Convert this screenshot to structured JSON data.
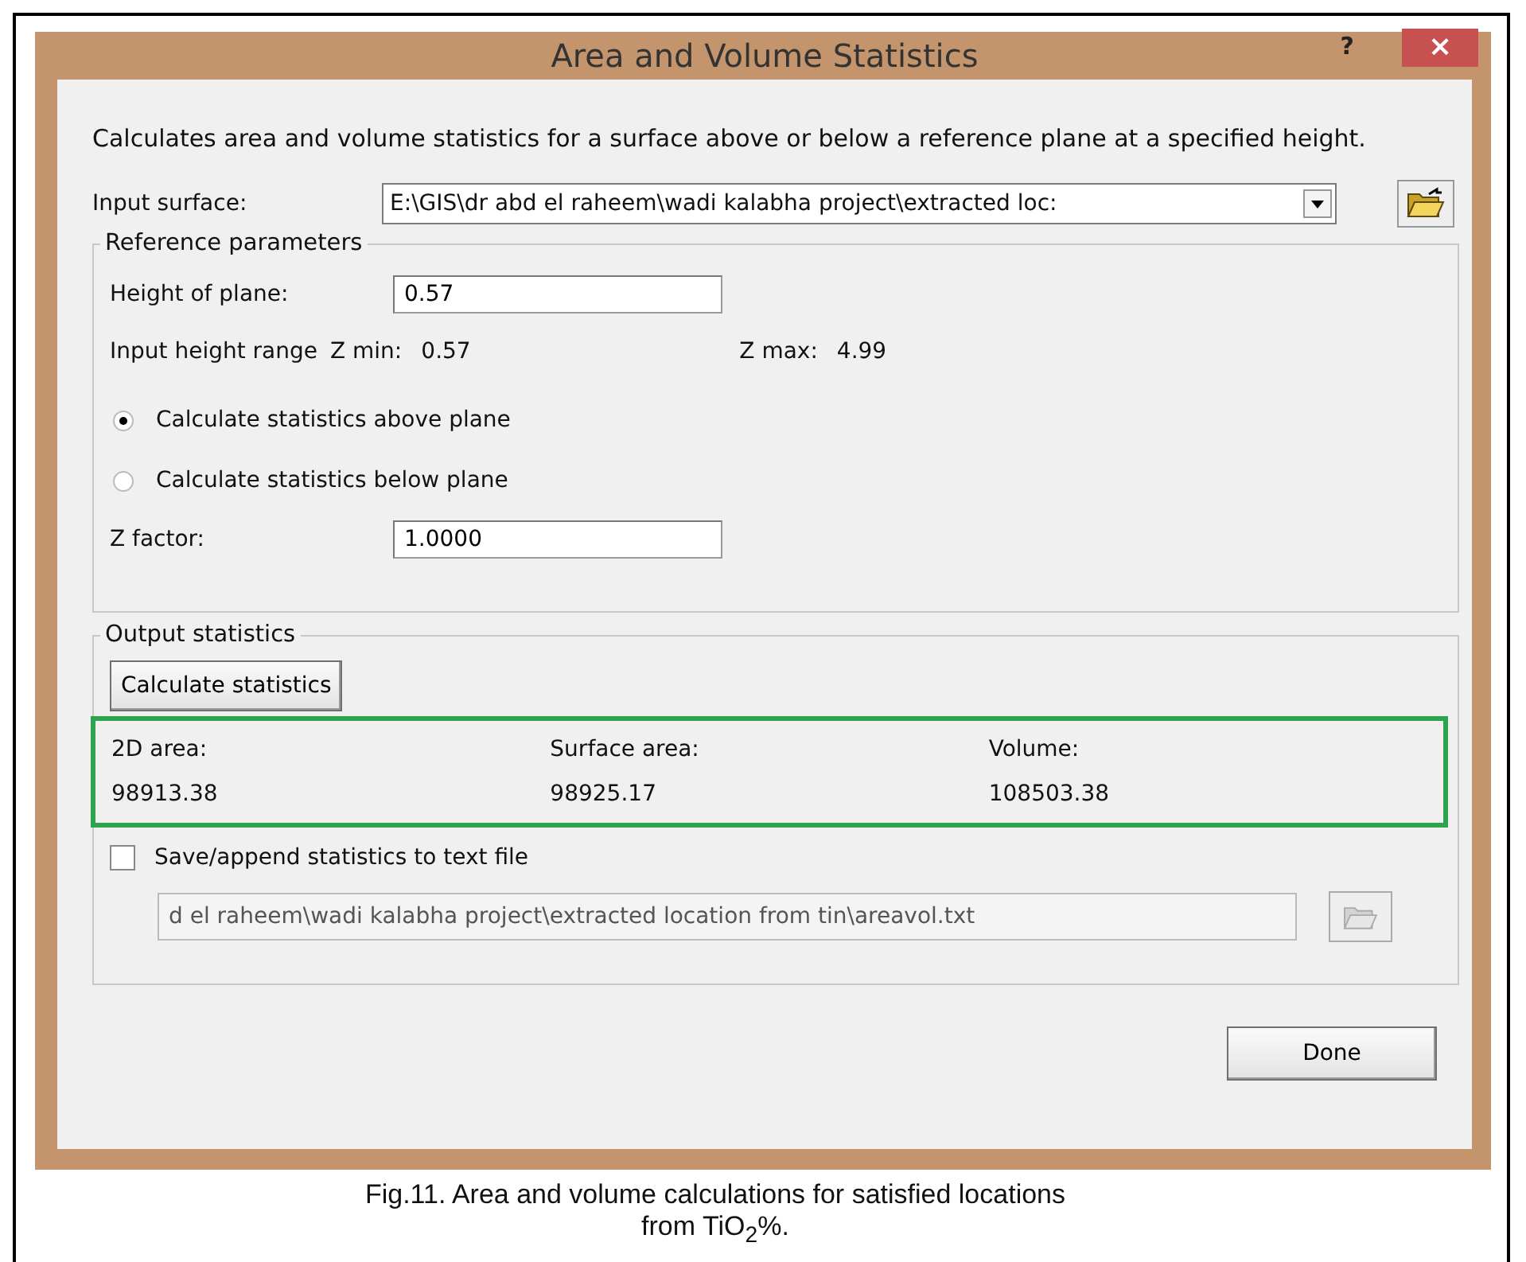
{
  "window": {
    "title": "Area and Volume Statistics",
    "help": "?",
    "close": "×"
  },
  "description": "Calculates area and volume statistics for a surface above or below a reference plane at a specified height.",
  "input_surface": {
    "label": "Input surface:",
    "value": "E:\\GIS\\dr abd el raheem\\wadi kalabha project\\extracted loc:"
  },
  "reference_parameters": {
    "title": "Reference parameters",
    "height_of_plane": {
      "label": "Height of plane:",
      "value": "0.57"
    },
    "input_height_range": {
      "label": "Input height range",
      "zmin_label": "Z min:",
      "zmin": "0.57",
      "zmax_label": "Z max:",
      "zmax": "4.99"
    },
    "options": [
      {
        "label": "Calculate statistics above plane",
        "selected": true
      },
      {
        "label": "Calculate statistics below plane",
        "selected": false
      }
    ],
    "z_factor": {
      "label": "Z factor:",
      "value": "1.0000"
    }
  },
  "output_statistics": {
    "title": "Output statistics",
    "button": "Calculate statistics",
    "columns": [
      {
        "label": "2D area:",
        "value": "98913.38"
      },
      {
        "label": "Surface area:",
        "value": "98925.17"
      },
      {
        "label": "Volume:",
        "value": "108503.38"
      }
    ],
    "save": {
      "label": "Save/append statistics to text file",
      "checked": false
    },
    "file": {
      "value": "d el raheem\\wadi kalabha project\\extracted location from tin\\areavol.txt",
      "disabled": true
    }
  },
  "done_button": "Done",
  "caption": [
    "Fig.11. Area and volume calculations for satisfied locations",
    "from TiO$_{2}$%."
  ]
}
